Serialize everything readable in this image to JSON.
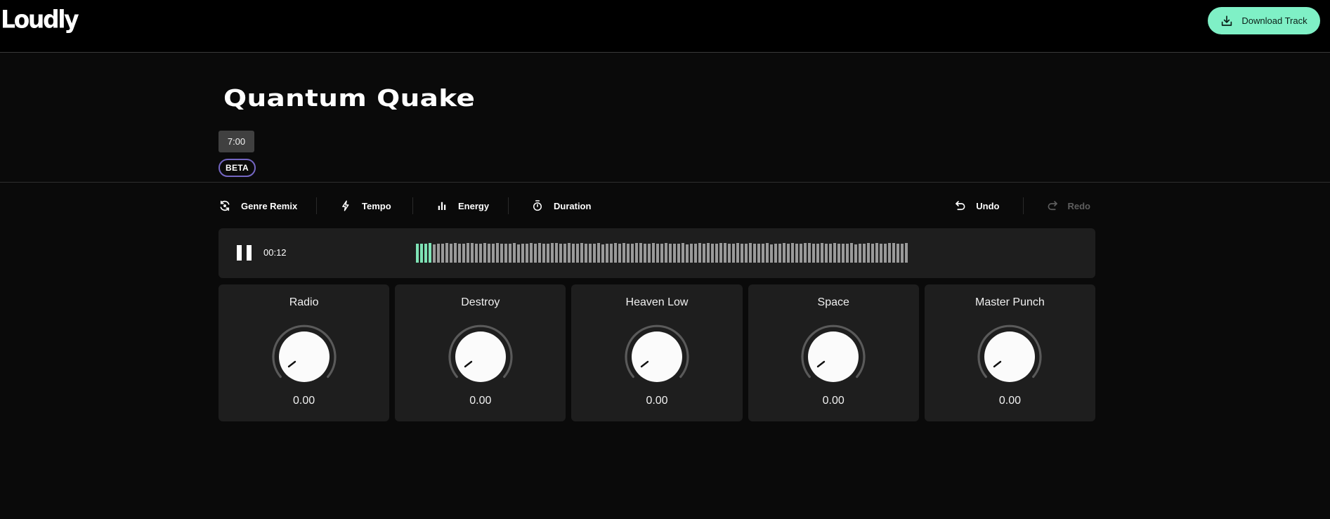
{
  "app": {
    "logo": "Loudly",
    "download_label": "Download Track"
  },
  "track": {
    "title": "Quantum Quake",
    "duration": "7:00",
    "badge": "BETA"
  },
  "toolbar": {
    "left": [
      {
        "label": "Genre Remix",
        "icon": "remix-icon"
      },
      {
        "label": "Tempo",
        "icon": "lightning-icon"
      },
      {
        "label": "Energy",
        "icon": "bar-chart-icon"
      },
      {
        "label": "Duration",
        "icon": "stopwatch-icon"
      }
    ],
    "undo_label": "Undo",
    "redo_label": "Redo"
  },
  "player": {
    "state": "playing",
    "current_time": "00:12",
    "played_fraction": 0.034,
    "bar_count": 117,
    "colors": {
      "played": "#7ee2b5",
      "unplayed": "#9a9a9a"
    }
  },
  "knobs": [
    {
      "label": "Radio",
      "value": "0.00"
    },
    {
      "label": "Destroy",
      "value": "0.00"
    },
    {
      "label": "Heaven Low",
      "value": "0.00"
    },
    {
      "label": "Space",
      "value": "0.00"
    },
    {
      "label": "Master Punch",
      "value": "0.00"
    }
  ],
  "colors": {
    "accent": "#7ff0c6",
    "beta_border": "#7466c2",
    "background": "#0a0a0a",
    "panel": "#1e1e1e"
  }
}
